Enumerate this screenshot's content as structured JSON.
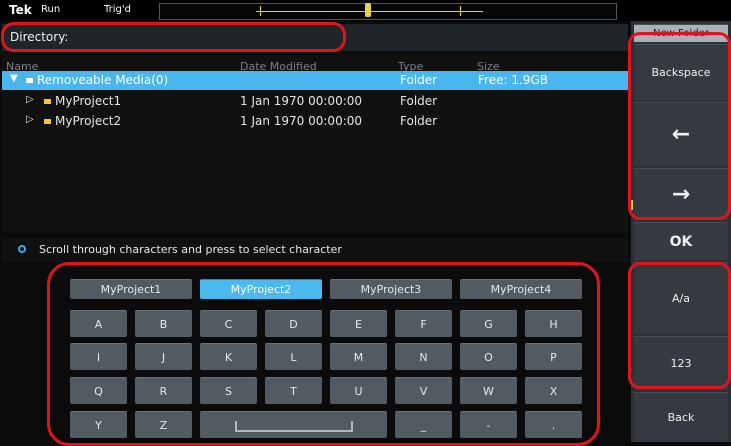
{
  "status_bar": {
    "logo": "Tek",
    "run_state": "Run",
    "trigger_state": "Trig'd"
  },
  "directory": {
    "label": "Directory:"
  },
  "file_list": {
    "headers": {
      "name": "Name",
      "date": "Date Modified",
      "type": "Type",
      "size": "Size"
    },
    "rows": [
      {
        "name": "Removeable Media(0)",
        "date": "",
        "type": "Folder",
        "size": "Free: 1.9GB",
        "expanded": true,
        "selected": true
      },
      {
        "name": "MyProject1",
        "date": "1 Jan 1970 00:00:00",
        "type": "Folder",
        "size": "",
        "expanded": false,
        "selected": false
      },
      {
        "name": "MyProject2",
        "date": "1 Jan 1970 00:00:00",
        "type": "Folder",
        "size": "",
        "expanded": false,
        "selected": false
      }
    ]
  },
  "hint": {
    "text": "Scroll through characters and press to select character"
  },
  "keyboard": {
    "presets": [
      "MyProject1",
      "MyProject2",
      "MyProject3",
      "MyProject4"
    ],
    "selected_preset": "MyProject2",
    "row1": [
      "A",
      "B",
      "C",
      "D",
      "E",
      "F",
      "G",
      "H"
    ],
    "row2": [
      "I",
      "J",
      "K",
      "L",
      "M",
      "N",
      "O",
      "P"
    ],
    "row3": [
      "Q",
      "R",
      "S",
      "T",
      "U",
      "V",
      "W",
      "X"
    ],
    "row4": [
      "Y",
      "Z",
      "",
      "",
      "_",
      "-",
      "."
    ]
  },
  "side_panel": {
    "new_folder": "New Folder",
    "backspace": "Backspace",
    "left_arrow": "←",
    "right_arrow": "→",
    "ok": "OK",
    "case": "A/a",
    "numeric": "123",
    "back": "Back"
  },
  "colors": {
    "selection": "#49b6ee",
    "annotation": "#e0141c",
    "folder": "#f4c542"
  }
}
